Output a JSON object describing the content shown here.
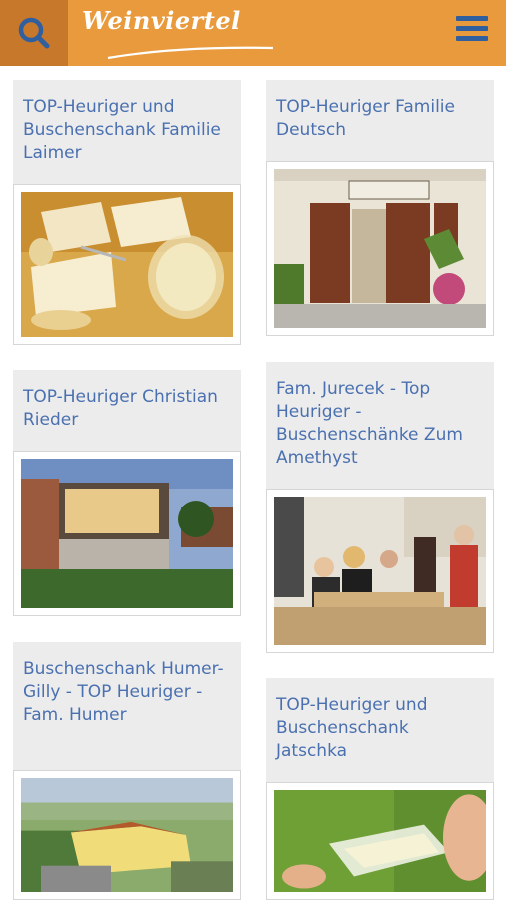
{
  "header": {
    "logo_text": "Weinviertel",
    "search_icon": "search-icon",
    "menu_icon": "hamburger-menu-icon",
    "brand_color": "#e89a3c",
    "search_bg": "#c8782a",
    "icon_color": "#2f5f9e"
  },
  "cards": [
    {
      "title": "TOP-Heuriger und Buschenschank Familie Laimer",
      "image": "cheese-and-wine-photo"
    },
    {
      "title": "TOP-Heuriger Familie Deutsch",
      "image": "heuriger-entrance-photo"
    },
    {
      "title": "TOP-Heuriger Christian Rieder",
      "image": "modern-winery-building-photo"
    },
    {
      "title": "Fam. Jurecek - Top Heuriger - Buschenschänke Zum Amethyst",
      "image": "guests-at-table-photo"
    },
    {
      "title": "Buschenschank Humer-Gilly - TOP Heuriger - Fam. Humer",
      "image": "aerial-farm-photo"
    },
    {
      "title": "TOP-Heuriger und Buschenschank Jatschka",
      "image": "wine-tasting-photo"
    }
  ]
}
